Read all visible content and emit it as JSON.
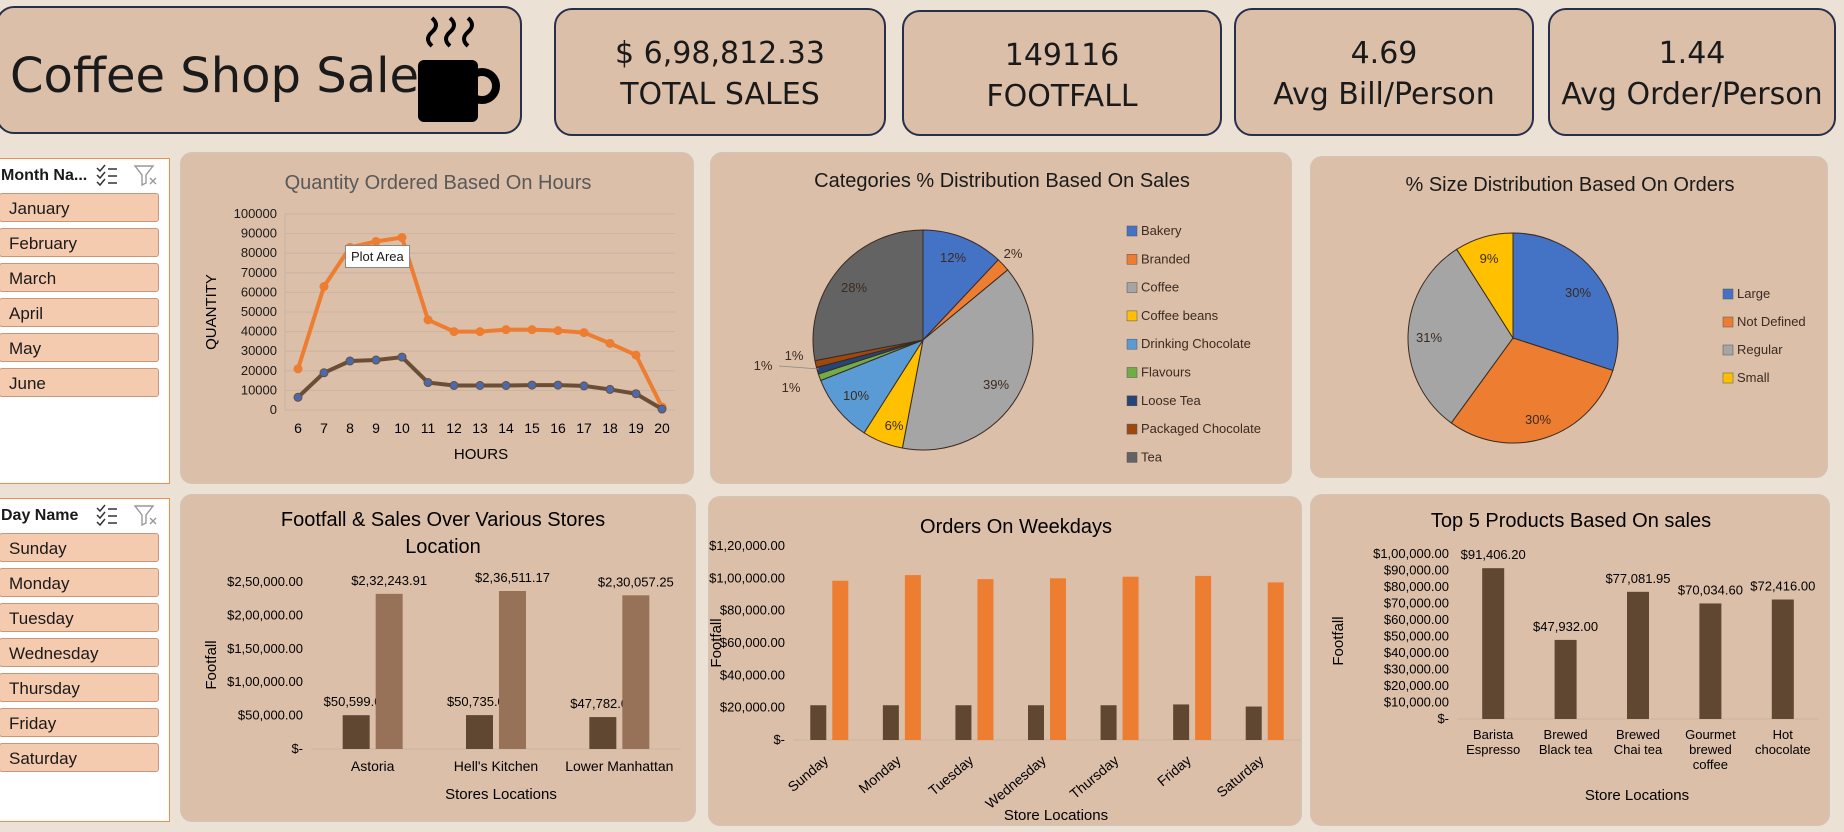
{
  "title": "Coffee Shop Sales",
  "kpis": [
    {
      "value": "$ 6,98,812.33",
      "label": "TOTAL SALES"
    },
    {
      "value": "149116",
      "label": "FOOTFALL"
    },
    {
      "value": "4.69",
      "label": "Avg Bill/Person"
    },
    {
      "value": "1.44",
      "label": "Avg Order/Person"
    }
  ],
  "slicers": {
    "month": {
      "header": "Month Na...",
      "items": [
        "January",
        "February",
        "March",
        "April",
        "May",
        "June"
      ]
    },
    "day": {
      "header": "Day Name",
      "items": [
        "Sunday",
        "Monday",
        "Tuesday",
        "Wednesday",
        "Thursday",
        "Friday",
        "Saturday"
      ]
    }
  },
  "colors": {
    "orange": "#ed7d31",
    "brown": "#6b4e36",
    "blue": "#4472c4",
    "gray": "#a5a5a5",
    "yellow": "#ffc000",
    "lightblue": "#5b9bd5",
    "green": "#70ad47",
    "navy": "#264478",
    "rust": "#9e480e",
    "darkgray": "#636363",
    "bar_brown": "#604732",
    "bar_tan": "#977258"
  },
  "tooltip": "Plot Area",
  "chart_data": [
    {
      "id": "hours",
      "type": "line",
      "title": "Quantity Ordered Based On Hours",
      "xlabel": "HOURS",
      "ylabel": "QUANTITY",
      "x": [
        6,
        7,
        8,
        9,
        10,
        11,
        12,
        13,
        14,
        15,
        16,
        17,
        18,
        19,
        20
      ],
      "ylim": [
        0,
        100000
      ],
      "yticks": [
        "0",
        "10000",
        "20000",
        "30000",
        "40000",
        "50000",
        "60000",
        "70000",
        "80000",
        "90000",
        "100000"
      ],
      "series": [
        {
          "color": "orange",
          "values": [
            21000,
            63000,
            83000,
            86000,
            88000,
            46000,
            40000,
            40000,
            41000,
            41000,
            40500,
            39500,
            34000,
            28000,
            1500
          ]
        },
        {
          "color": "brown",
          "values": [
            6500,
            19000,
            25000,
            25500,
            27000,
            14000,
            12500,
            12500,
            12500,
            12700,
            12700,
            12300,
            10500,
            8300,
            500
          ]
        }
      ]
    },
    {
      "id": "categories",
      "type": "pie",
      "title": "Categories % Distribution Based On Sales",
      "slices": [
        {
          "name": "Bakery",
          "value": 12,
          "label": "12%",
          "color": "blue"
        },
        {
          "name": "Branded",
          "value": 2,
          "label": "2%",
          "color": "orange"
        },
        {
          "name": "Coffee",
          "value": 39,
          "label": "39%",
          "color": "gray"
        },
        {
          "name": "Coffee beans",
          "value": 6,
          "label": "6%",
          "color": "yellow"
        },
        {
          "name": "Drinking Chocolate",
          "value": 10,
          "label": "10%",
          "color": "lightblue"
        },
        {
          "name": "Flavours",
          "value": 1,
          "label": "1%",
          "color": "green"
        },
        {
          "name": "Loose Tea",
          "value": 1,
          "label": "1%",
          "color": "navy"
        },
        {
          "name": "Packaged Chocolate",
          "value": 1,
          "label": "1%",
          "color": "rust"
        },
        {
          "name": "Tea",
          "value": 28,
          "label": "28%",
          "color": "darkgray"
        }
      ]
    },
    {
      "id": "sizes",
      "type": "pie",
      "title": "% Size Distribution Based On Orders",
      "slices": [
        {
          "name": "Large",
          "value": 30,
          "label": "30%",
          "color": "blue"
        },
        {
          "name": "Not Defined",
          "value": 30,
          "label": "30%",
          "color": "orange"
        },
        {
          "name": "Regular",
          "value": 31,
          "label": "31%",
          "color": "gray"
        },
        {
          "name": "Small",
          "value": 9,
          "label": "9%",
          "color": "yellow"
        }
      ]
    },
    {
      "id": "stores",
      "type": "bar",
      "title": "Footfall & Sales Over Various Stores Location",
      "title_lines": [
        "Footfall & Sales Over Various Stores",
        "Location"
      ],
      "xlabel": "Stores Locations",
      "ylabel": "Footfall",
      "categories": [
        "Astoria",
        "Hell's Kitchen",
        "Lower Manhattan"
      ],
      "ylim": [
        0,
        250000
      ],
      "yticks": [
        "$-",
        "$50,000.00",
        "$1,00,000.00",
        "$1,50,000.00",
        "$2,00,000.00",
        "$2,50,000.00"
      ],
      "series": [
        {
          "color": "bar_brown",
          "values": [
            50599,
            50735,
            47782
          ],
          "labels": [
            "$50,599.00",
            "$50,735.00",
            "$47,782.00"
          ]
        },
        {
          "color": "bar_tan",
          "values": [
            232243.91,
            236511.17,
            230057.25
          ],
          "labels": [
            "$2,32,243.91",
            "$2,36,511.17",
            "$2,30,057.25"
          ]
        }
      ]
    },
    {
      "id": "weekdays",
      "type": "bar",
      "title": "Orders On Weekdays",
      "xlabel": "Store Locations",
      "ylabel": "Footfall",
      "categories": [
        "Sunday",
        "Monday",
        "Tuesday",
        "Wednesday",
        "Thursday",
        "Friday",
        "Saturday"
      ],
      "ylim": [
        0,
        120000
      ],
      "yticks": [
        "$-",
        "$20,000.00",
        "$40,000.00",
        "$60,000.00",
        "$80,000.00",
        "$1,00,000.00",
        "$1,20,000.00"
      ],
      "series": [
        {
          "color": "bar_brown",
          "values": [
            21500,
            21500,
            21500,
            21500,
            21500,
            22000,
            20700
          ]
        },
        {
          "color": "orange",
          "values": [
            98500,
            102000,
            99500,
            100000,
            101000,
            101500,
            97500
          ]
        }
      ]
    },
    {
      "id": "products",
      "type": "bar",
      "title": "Top 5 Products Based On sales",
      "xlabel": "Store Locations",
      "ylabel": "Footfall",
      "categories": [
        [
          "Barista",
          "Espresso"
        ],
        [
          "Brewed",
          "Black tea"
        ],
        [
          "Brewed",
          "Chai tea"
        ],
        [
          "Gourmet",
          "brewed",
          "coffee"
        ],
        [
          "Hot",
          "chocolate"
        ]
      ],
      "ylim": [
        0,
        100000
      ],
      "yticks": [
        "$-",
        "$10,000.00",
        "$20,000.00",
        "$30,000.00",
        "$40,000.00",
        "$50,000.00",
        "$60,000.00",
        "$70,000.00",
        "$80,000.00",
        "$90,000.00",
        "$1,00,000.00"
      ],
      "series": [
        {
          "color": "bar_brown",
          "values": [
            91406.2,
            47932.0,
            77081.95,
            70034.6,
            72416.0
          ],
          "labels": [
            "$91,406.20",
            "$47,932.00",
            "$77,081.95",
            "$70,034.60",
            "$72,416.00"
          ]
        }
      ]
    }
  ]
}
